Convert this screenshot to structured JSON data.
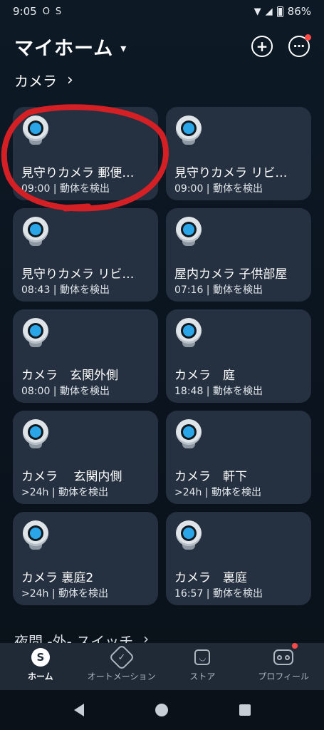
{
  "status_bar": {
    "time": "9:05",
    "app_icons": [
      "O",
      "S"
    ],
    "battery": "86%"
  },
  "header": {
    "title": "マイホーム",
    "caret": "▾",
    "add_icon": "+",
    "more_icon": "⋯"
  },
  "cameras_section": {
    "title": "カメラ",
    "chevron": "›"
  },
  "cameras": [
    {
      "name": "見守りカメラ 郵便…",
      "status": "09:00 | 動体を検出"
    },
    {
      "name": "見守りカメラ リビ…",
      "status": "09:00 | 動体を検出"
    },
    {
      "name": "見守りカメラ リビ…",
      "status": "08:43 | 動体を検出"
    },
    {
      "name": "屋内カメラ 子供部屋",
      "status": "07:16 | 動体を検出"
    },
    {
      "name": "カメラ　玄関外側",
      "status": "08:00 | 動体を検出"
    },
    {
      "name": "カメラ　庭",
      "status": "18:48 | 動体を検出"
    },
    {
      "name": "カメラ　 玄関内側",
      "status": ">24h | 動体を検出"
    },
    {
      "name": "カメラ　軒下",
      "status": ">24h | 動体を検出"
    },
    {
      "name": "カメラ 裏庭2",
      "status": ">24h | 動体を検出"
    },
    {
      "name": "カメラ　裏庭",
      "status": "16:57 | 動体を検出"
    }
  ],
  "second_section": {
    "title": "夜間 -外- スイッチ",
    "chevron": "›"
  },
  "bottom_nav": {
    "items": [
      {
        "label": "ホーム",
        "icon_glyph": "S"
      },
      {
        "label": "オートメーション",
        "icon_glyph": "✓"
      },
      {
        "label": "ストア",
        "icon_glyph": "◡"
      },
      {
        "label": "プロフィール"
      }
    ]
  },
  "colors": {
    "background": "#0b1520",
    "card": "#253140",
    "accent_lens": "#2aa6e8",
    "badge": "#ff4a4a",
    "annotation": "#d41f25"
  }
}
